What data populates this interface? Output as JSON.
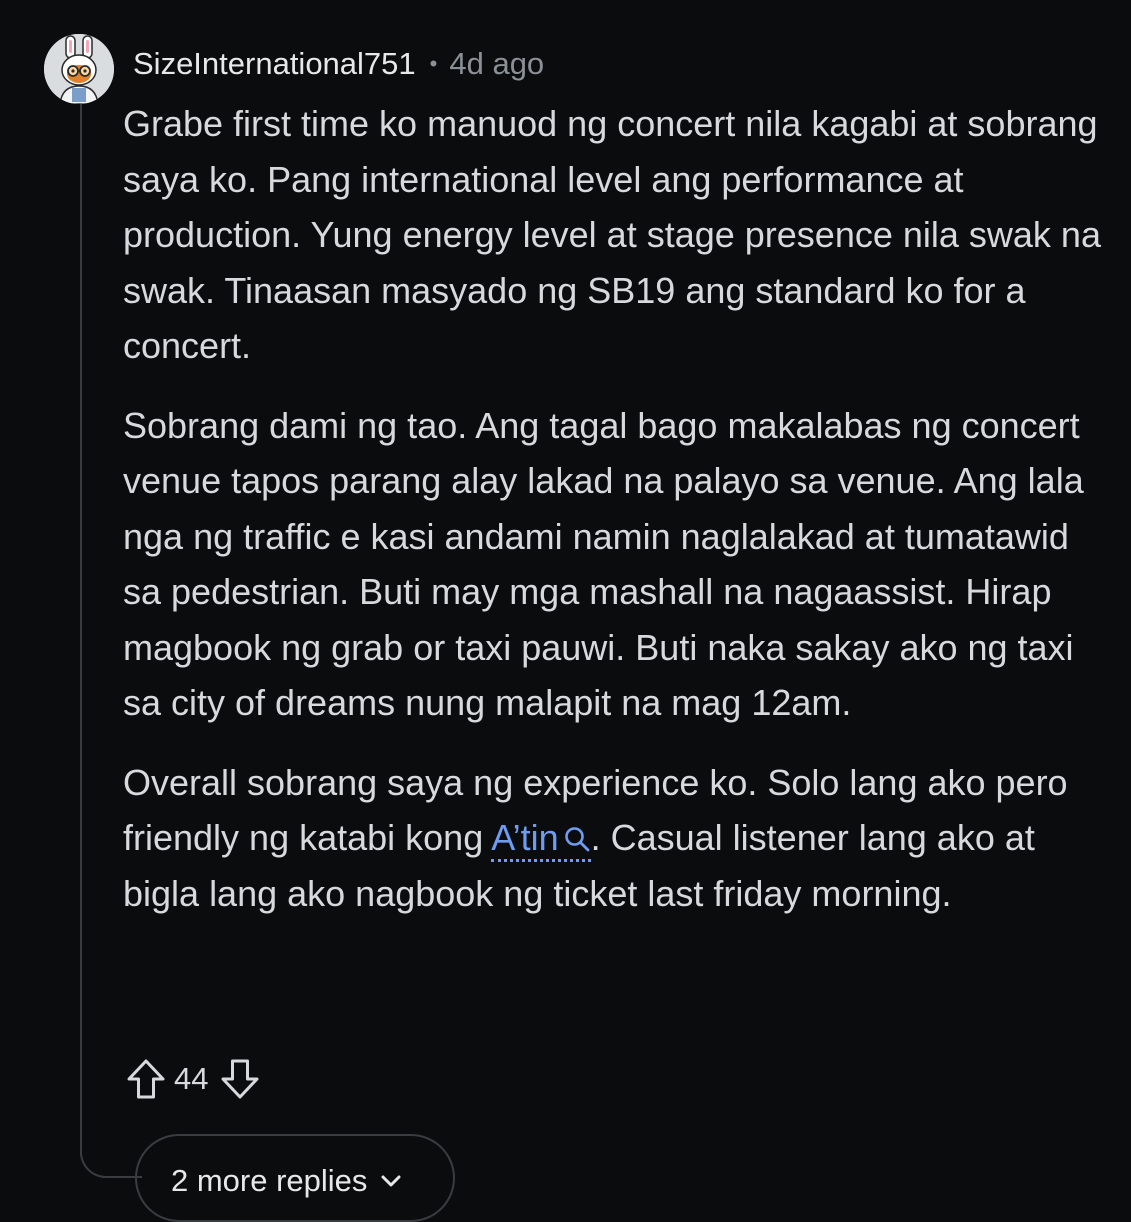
{
  "comment": {
    "username": "SizeInternational751",
    "separator": "•",
    "timestamp": "4d ago",
    "avatar_icon": "avatar-bunny-icon",
    "paragraphs": {
      "p1": "Grabe first time ko manuod ng concert nila kagabi at sobrang saya ko. Pang international level ang performance at production. Yung energy level at stage presence nila swak na swak. Tinaasan masyado ng SB19 ang standard ko for a concert.",
      "p2": "Sobrang dami ng tao. Ang tagal bago makalabas ng concert venue tapos parang alay lakad na palayo sa venue. Ang lala nga ng traffic e kasi andami namin naglalakad at tumatawid sa pedestrian. Buti may mga mashall na nagaassist. Hirap magbook ng grab or taxi pauwi. Buti naka sakay ako ng taxi sa city of dreams nung malapit na mag 12am.",
      "p3_before": "Overall sobrang saya ng experience ko. Solo lang ako pero friendly ng katabi kong ",
      "p3_link": "A’tin",
      "p3_after": ". Casual listener lang ako at bigla lang ako nagbook ng ticket last friday morning."
    },
    "votes": {
      "score": "44",
      "upvote_icon": "upvote-arrow-icon",
      "downvote_icon": "downvote-arrow-icon"
    },
    "more_replies": {
      "label": "2 more replies",
      "icon": "chevron-down-icon"
    }
  },
  "colors": {
    "background": "#0b0c0e",
    "text": "#d7dadc",
    "meta": "#8a9096",
    "link": "#6f9cf0",
    "thread_line": "#3a3d40"
  }
}
